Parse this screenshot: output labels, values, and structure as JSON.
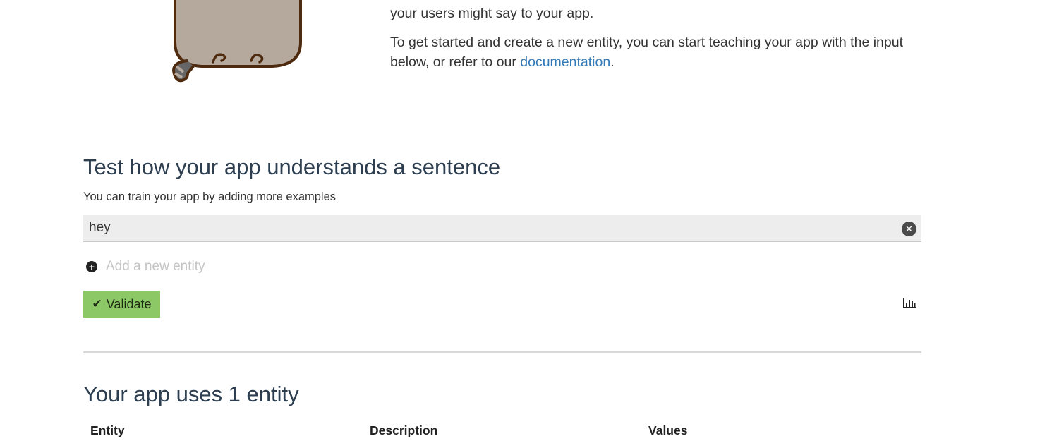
{
  "intro": {
    "line1": "your users might say to your app.",
    "line2_prefix": "To get started and create a new entity, you can start teaching your app with the input below, or refer to our ",
    "line2_link": "documentation",
    "line2_suffix": "."
  },
  "test": {
    "title": "Test how your app understands a sentence",
    "subtitle": "You can train your app by adding more examples",
    "sentence_value": "hey",
    "clear_icon": "close-icon",
    "add_entity_label": "Add a new entity",
    "add_entity_icon": "plus-circle-icon",
    "validate_label": "Validate",
    "validate_icon": "check-icon",
    "stats_icon": "bar-chart-icon",
    "validate_color": "#8cc866"
  },
  "entities": {
    "title": "Your app uses 1 entity",
    "columns": [
      "Entity",
      "Description",
      "Values"
    ]
  },
  "colors": {
    "link": "#337ab7",
    "heading": "#2c3e50",
    "mascot_body": "#b5a89c",
    "mascot_outline": "#4e2b0f"
  }
}
